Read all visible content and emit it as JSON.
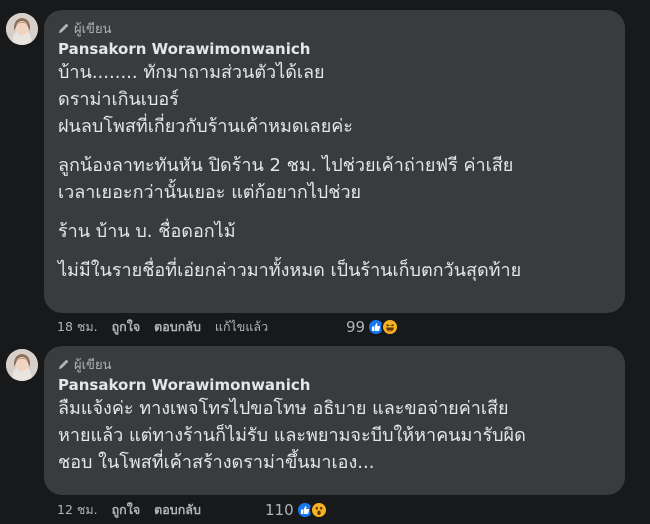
{
  "comments": [
    {
      "badge": "ผู้เขียน",
      "name": "Pansakorn Worawimonwanich",
      "paragraphs": [
        "บ้าน........ ทักมาถามส่วนตัวได้เลย\nดราม่าเกินเบอร์\nฝนลบโพสที่เกี่ยวกับร้านเค้าหมดเลยค่ะ",
        "ลูกน้องลาทะทันหัน ปิดร้าน 2 ชม. ไปช่วยเค้าถ่ายฟรี ค่าเสีย\nเวลาเยอะกว่านั้นเยอะ แต่ก้อยากไปช่วย",
        "ร้าน บ้าน บ. ชื่อดอกไม้",
        "ไม่มีในรายชื่อที่เอ่ยกล่าวมาทั้งหมด เป็นร้านเก็บตกวันสุดท้าย"
      ],
      "time": "18 ชม.",
      "like_label": "ถูกใจ",
      "reply_label": "ตอบกลับ",
      "edited_label": "แก้ไขแล้ว",
      "reaction_count": "99",
      "reactions": [
        "like-reaction-icon",
        "haha-reaction-icon"
      ]
    },
    {
      "badge": "ผู้เขียน",
      "name": "Pansakorn Worawimonwanich",
      "paragraphs": [
        "ลืมแจ้งค่ะ ทางเพจโทรไปขอโทษ อธิบาย และขอจ่ายค่าเสีย\nหายแล้ว แต่ทางร้านก็ไม่รับ และพยามจะบีบให้หาคนมารับผิด\nชอบ ในโพสที่เค้าสร้างดราม่าขึ้นมาเอง..."
      ],
      "time": "12 ชม.",
      "like_label": "ถูกใจ",
      "reply_label": "ตอบกลับ",
      "reaction_count": "110",
      "reactions": [
        "like-reaction-icon",
        "wow-reaction-icon"
      ]
    }
  ],
  "colors": {
    "background": "#18191a",
    "bubble": "#3a3b3c",
    "text": "#e4e6eb",
    "secondary_text": "#b0b3b8",
    "like_blue": "#1877f2",
    "emoji_yellow": "#f7b125"
  }
}
